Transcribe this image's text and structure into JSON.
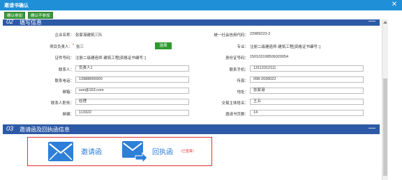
{
  "window": {
    "title": "邀请书确认",
    "close_glyph": "✕"
  },
  "toolbar": {
    "confirm_join": "确认参加",
    "confirm_decline": "确认不参加"
  },
  "section2": {
    "number": "02",
    "label": "填写信息",
    "min_glyph": "—"
  },
  "form": {
    "company_label": "企业名称：",
    "company_value": "张家港建筑三队",
    "credit_label": "统一社会信用代码：",
    "credit_value": "23989223-2",
    "pm_label": "项目负责人：",
    "pm_value": "张三",
    "choose_btn": "选择",
    "major_label": "专业：",
    "major_value": "注册二级建造师-建筑工程[资格证书编号：]",
    "cert_label": "证件号码：",
    "cert_value": "注册二级建造师-建筑工程[资格证书编号：]",
    "id_label": "身份证号码：",
    "id_value": "150103198506020054",
    "contact_label": "联系人：",
    "contact_value": "负责人1",
    "mobile_label": "联系手机：",
    "mobile_value": "13112312111",
    "phone_label": "联系电话：",
    "phone_value": "13988899900",
    "fax_label": "传真：",
    "fax_value": "098-2039022",
    "email_label": "邮箱：",
    "email_value": "sun@163.com",
    "address_label": "地址：",
    "address_value": "张家港",
    "duty_label": "联系人职务：",
    "duty_value": "经理",
    "trade_label": "交易主体姓名：",
    "trade_value": "王五",
    "zip_label": "邮编：",
    "zip_value": "113322",
    "pages_label": "邀请书页数：",
    "pages_value": "14"
  },
  "section3": {
    "number": "03",
    "label": "邀请函及回执函信息",
    "min_glyph": "—"
  },
  "docs": {
    "invite_label": "邀请函",
    "receipt_label": "回执函",
    "signed_tag": "（已签章）"
  },
  "colors": {
    "titlebar": "#1f8fd8",
    "section": "#2d5aa7",
    "green": "#3a9a3a",
    "red": "#e03030",
    "icon_blue": "#2d7fd8"
  },
  "icons": [
    "close-icon",
    "envelope-icon",
    "forward-envelope-icon"
  ]
}
